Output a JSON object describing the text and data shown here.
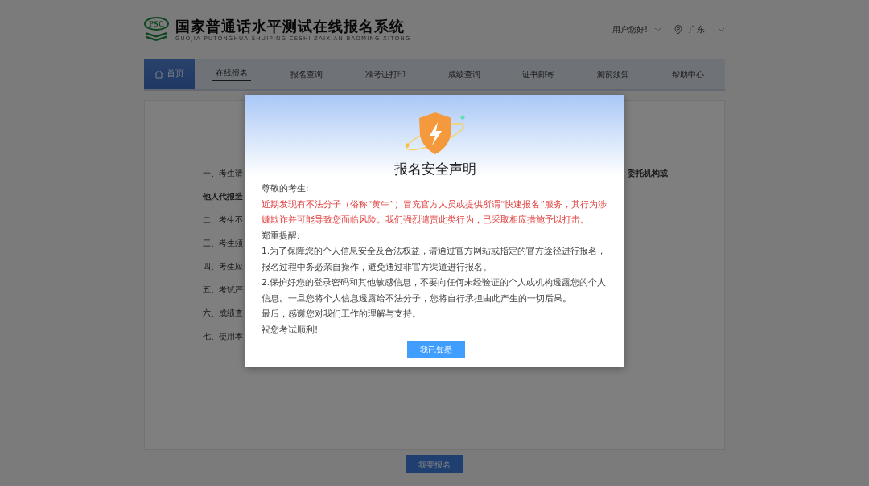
{
  "header": {
    "logo_text": "PSC",
    "title": "国家普通话水平测试在线报名系统",
    "subtitle": "GUOJIA PUTONGHUA SHUIPING CESHI ZAIXIAN BAOMING XITONG",
    "user_menu": "用户您好!",
    "region": "广东"
  },
  "nav": [
    {
      "label": "首页",
      "kind": "home",
      "selected": true,
      "underlined": false
    },
    {
      "label": "在线报名",
      "kind": "link",
      "selected": false,
      "underlined": true
    },
    {
      "label": "报名查询",
      "kind": "link",
      "selected": false,
      "underlined": false
    },
    {
      "label": "准考证打印",
      "kind": "link",
      "selected": false,
      "underlined": false
    },
    {
      "label": "成绩查询",
      "kind": "link",
      "selected": false,
      "underlined": false
    },
    {
      "label": "证书邮寄",
      "kind": "link",
      "selected": false,
      "underlined": false
    },
    {
      "label": "测前须知",
      "kind": "link",
      "selected": false,
      "underlined": false
    },
    {
      "label": "帮助中心",
      "kind": "link",
      "selected": false,
      "underlined": false
    }
  ],
  "notice_lines": [
    {
      "left": "一、考生请",
      "left_bold": false,
      "right": "委托机构或",
      "right_bold": true
    },
    {
      "left": "他人代报造",
      "left_bold": true
    },
    {
      "left": "二、考生不",
      "left_bold": false
    },
    {
      "left": "三、考生须",
      "left_bold": false
    },
    {
      "left": "四、考生应",
      "left_bold": false
    },
    {
      "left": "五、考试严",
      "left_bold": false
    },
    {
      "left": "六、成绩查",
      "left_bold": false
    },
    {
      "left": "七、使用本",
      "left_bold": false
    }
  ],
  "register_button": "我要报名",
  "modal": {
    "title": "报名安全声明",
    "paragraphs": [
      {
        "kind": "normal",
        "text": "尊敬的考生:"
      },
      {
        "kind": "warning",
        "text": "近期发现有不法分子（俗称“黄牛”）冒充官方人员或提供所谓“快速报名”服务，其行为涉嫌欺诈并可能导致您面临风险。我们强烈谴责此类行为，已采取相应措施予以打击。"
      },
      {
        "kind": "normal",
        "text": "郑重提醒:"
      },
      {
        "kind": "normal",
        "text": "1.为了保障您的个人信息安全及合法权益，请通过官方网站或指定的官方途径进行报名，报名过程中务必亲自操作，避免通过非官方渠道进行报名。"
      },
      {
        "kind": "normal",
        "text": "2.保护好您的登录密码和其他敏感信息，不要向任何未经验证的个人或机构透露您的个人信息。一旦您将个人信息透露给不法分子，您将自行承担由此产生的一切后果。"
      },
      {
        "kind": "normal",
        "text": "最后，感谢您对我们工作的理解与支持。"
      },
      {
        "kind": "normal",
        "text": "祝您考试顺利!"
      }
    ],
    "button": "我已知悉"
  }
}
